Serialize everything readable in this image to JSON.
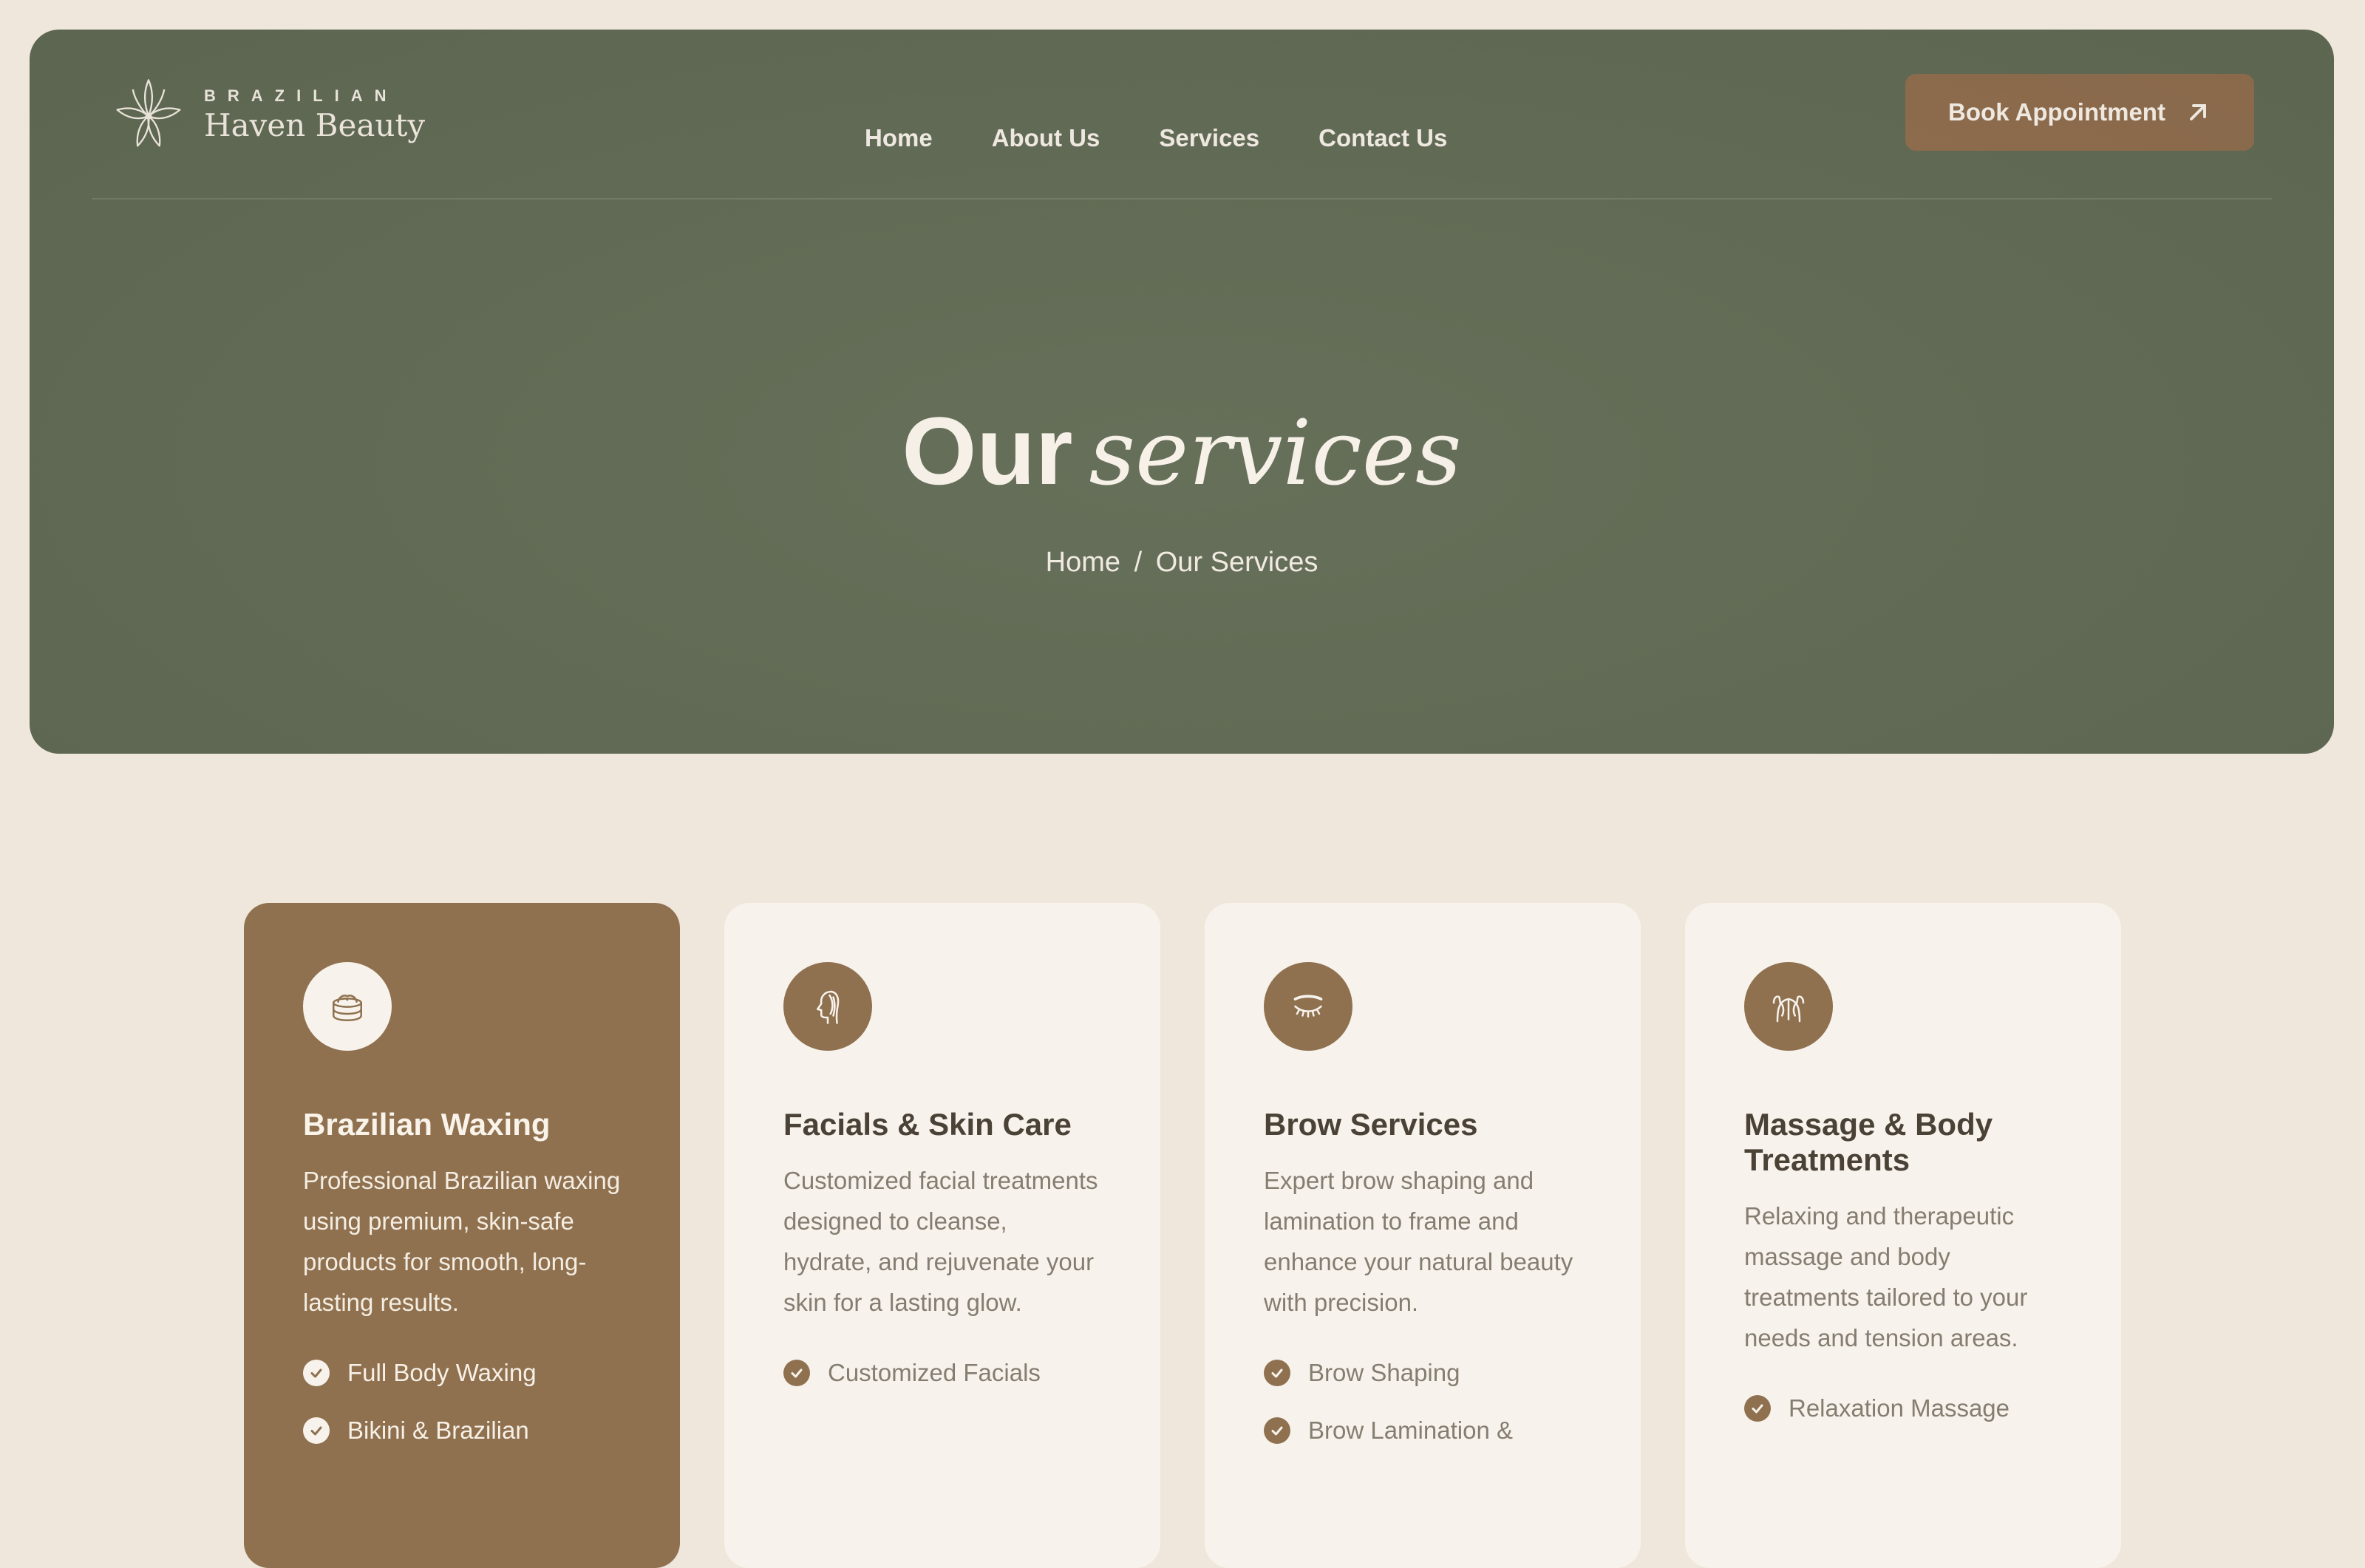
{
  "brand": {
    "top": "BRAZILIAN",
    "name": "Haven Beauty"
  },
  "nav": [
    {
      "label": "Home"
    },
    {
      "label": "About Us"
    },
    {
      "label": "Services"
    },
    {
      "label": "Contact Us"
    }
  ],
  "book_button": {
    "label": "Book Appointment"
  },
  "hero": {
    "title_plain": "Our",
    "title_italic": "services"
  },
  "breadcrumb": {
    "home": "Home",
    "separator": "/",
    "current": "Our Services"
  },
  "colors": {
    "hero_bg": "#616b54",
    "accent_brown": "#8f7150",
    "page_bg": "#efe7dc",
    "card_bg": "#f7f3ec"
  },
  "cards": [
    {
      "icon": "wax-jar-icon",
      "title": "Brazilian Waxing",
      "description": "Professional Brazilian waxing using premium, skin-safe products for smooth, long-lasting results.",
      "items": [
        "Full Body Waxing",
        "Bikini & Brazilian"
      ]
    },
    {
      "icon": "face-profile-icon",
      "title": "Facials & Skin Care",
      "description": "Customized facial treatments designed to cleanse, hydrate, and rejuvenate your skin for a lasting glow.",
      "items": [
        "Customized Facials"
      ]
    },
    {
      "icon": "closed-eye-lashes-icon",
      "title": "Brow Services",
      "description": "Expert brow shaping and lamination to frame and enhance your natural beauty with precision.",
      "items": [
        "Brow Shaping",
        "Brow Lamination &"
      ]
    },
    {
      "icon": "back-massage-icon",
      "title": "Massage & Body Treatments",
      "description": "Relaxing and therapeutic massage and body treatments tailored to your needs and tension areas.",
      "items": [
        "Relaxation Massage"
      ]
    }
  ]
}
